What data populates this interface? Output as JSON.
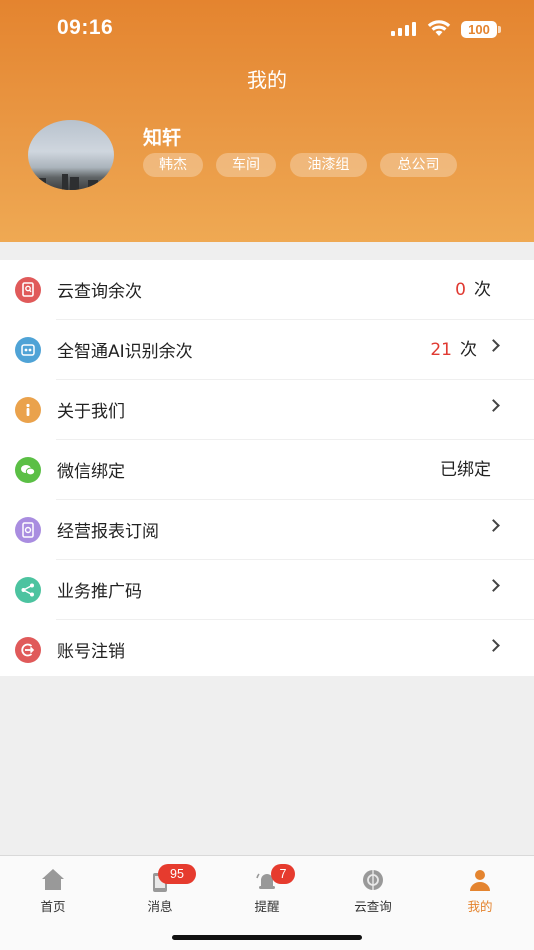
{
  "status_bar": {
    "time": "09:16",
    "battery": "100"
  },
  "header": {
    "title": "我的",
    "user_name": "知轩",
    "tags": [
      "韩杰",
      "车间",
      "油漆组",
      "总公司"
    ]
  },
  "menu": [
    {
      "label": "云查询余次",
      "count": "0",
      "unit": "次",
      "icon": "search-doc-icon",
      "color": "#e05a5a",
      "chevron": false
    },
    {
      "label": "全智通AI识别余次",
      "count": "21",
      "unit": "次",
      "icon": "ai-scan-icon",
      "color": "#4fa3d6",
      "chevron": true
    },
    {
      "label": "关于我们",
      "icon": "info-icon",
      "color": "#eaa24c",
      "chevron": true
    },
    {
      "label": "微信绑定",
      "value": "已绑定",
      "icon": "wechat-icon",
      "color": "#5bbf45",
      "chevron": false
    },
    {
      "label": "经营报表订阅",
      "icon": "report-icon",
      "color": "#a98de0",
      "chevron": true
    },
    {
      "label": "业务推广码",
      "icon": "share-icon",
      "color": "#4cc3a0",
      "chevron": true
    },
    {
      "label": "账号注销",
      "icon": "logout-icon",
      "color": "#e05a5a",
      "chevron": true
    }
  ],
  "tabbar": {
    "tabs": [
      {
        "label": "首页",
        "icon": "home-icon"
      },
      {
        "label": "消息",
        "icon": "message-icon",
        "badge": "95"
      },
      {
        "label": "提醒",
        "icon": "bell-icon",
        "badge": "7"
      },
      {
        "label": "云查询",
        "icon": "cloud-query-icon"
      },
      {
        "label": "我的",
        "icon": "profile-icon",
        "active": true
      }
    ]
  },
  "colors": {
    "accent": "#e4842f",
    "badge": "#e63b2e",
    "count_red": "#e03a32"
  }
}
